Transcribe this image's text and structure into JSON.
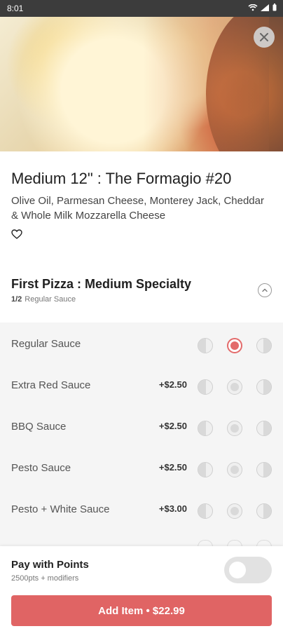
{
  "status_bar": {
    "time": "8:01"
  },
  "item": {
    "title": "Medium 12\" : The Formagio #20",
    "description": "Olive Oil, Parmesan Cheese, Monterey Jack, Cheddar & Whole Milk Mozzarella Cheese"
  },
  "section": {
    "title": "First Pizza : Medium Specialty",
    "count": "1/2",
    "subtitle": "Regular Sauce"
  },
  "options": [
    {
      "label": "Regular Sauce",
      "price": ""
    },
    {
      "label": "Extra Red Sauce",
      "price": "+$2.50"
    },
    {
      "label": "BBQ Sauce",
      "price": "+$2.50"
    },
    {
      "label": "Pesto Sauce",
      "price": "+$2.50"
    },
    {
      "label": "Pesto + White Sauce",
      "price": "+$3.00"
    }
  ],
  "points": {
    "title": "Pay with Points",
    "subtitle": "2500pts + modifiers"
  },
  "action": {
    "label": "Add Item • $22.99"
  },
  "colors": {
    "accent": "#e06464",
    "selected": "#e36b6b"
  },
  "icons": {
    "close": "close-icon",
    "favorite": "heart-icon",
    "collapse": "chevron-up-icon"
  }
}
